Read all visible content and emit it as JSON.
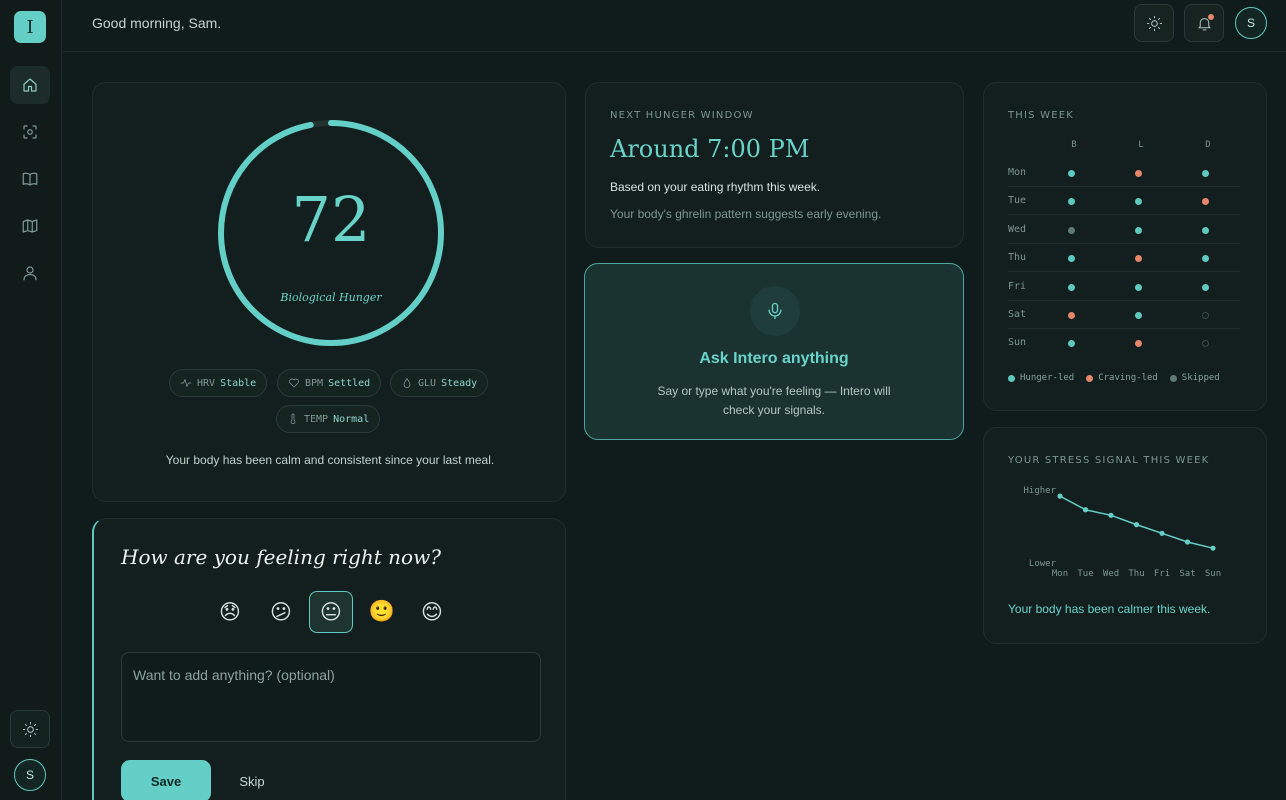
{
  "app": {
    "logo_letter": "I"
  },
  "header": {
    "greeting": "Good morning, Sam.",
    "avatar_initial": "S"
  },
  "sidebar": {
    "items": [
      {
        "name": "home",
        "active": true
      },
      {
        "name": "scan",
        "active": false
      },
      {
        "name": "journal",
        "active": false
      },
      {
        "name": "map",
        "active": false
      },
      {
        "name": "profile",
        "active": false
      }
    ],
    "avatar_initial": "S"
  },
  "hunger": {
    "value": "72",
    "value_fraction": 0.97,
    "label": "Biological Hunger",
    "chips": [
      {
        "key": "HRV",
        "value": "Stable",
        "icon": "pulse-icon"
      },
      {
        "key": "BPM",
        "value": "Settled",
        "icon": "heart-icon"
      },
      {
        "key": "GLU",
        "value": "Steady",
        "icon": "drop-icon"
      },
      {
        "key": "TEMP",
        "value": "Normal",
        "icon": "thermometer-icon"
      }
    ],
    "note": "Your body has been calm and consistent since your last meal."
  },
  "feeling": {
    "title": "How are you feeling right now?",
    "emojis": [
      "😞",
      "😕",
      "😐",
      "🙂",
      "😊"
    ],
    "selected_index": 2,
    "placeholder": "Want to add anything? (optional)",
    "save_label": "Save",
    "skip_label": "Skip"
  },
  "next_window": {
    "eyebrow": "NEXT HUNGER WINDOW",
    "time": "Around 7:00 PM",
    "line1": "Based on your eating rhythm this week.",
    "line2": "Your body's ghrelin pattern suggests early evening."
  },
  "ask": {
    "title": "Ask Intero anything",
    "subtitle": "Say or type what you're feeling — Intero will check your signals."
  },
  "week": {
    "eyebrow": "THIS WEEK",
    "columns": [
      "B",
      "L",
      "D"
    ],
    "rows": [
      {
        "day": "Mon",
        "meals": [
          "hunger",
          "craving",
          "hunger"
        ]
      },
      {
        "day": "Tue",
        "meals": [
          "hunger",
          "hunger",
          "craving"
        ]
      },
      {
        "day": "Wed",
        "meals": [
          "skipped",
          "hunger",
          "hunger"
        ]
      },
      {
        "day": "Thu",
        "meals": [
          "hunger",
          "craving",
          "hunger"
        ]
      },
      {
        "day": "Fri",
        "meals": [
          "hunger",
          "hunger",
          "hunger"
        ]
      },
      {
        "day": "Sat",
        "meals": [
          "craving",
          "hunger",
          "none"
        ]
      },
      {
        "day": "Sun",
        "meals": [
          "hunger",
          "craving",
          "none"
        ]
      }
    ],
    "legend": [
      {
        "key": "hunger",
        "label": "Hunger-led"
      },
      {
        "key": "craving",
        "label": "Craving-led"
      },
      {
        "key": "skipped",
        "label": "Skipped"
      }
    ],
    "colors": {
      "hunger": "#5fc9bf",
      "craving": "#e6876b",
      "skipped": "#5f7a76",
      "none": "#3a4b49"
    }
  },
  "stress": {
    "eyebrow": "YOUR STRESS SIGNAL THIS WEEK",
    "note": "Your body has been calmer this week.",
    "chart_data": {
      "type": "line",
      "categories": [
        "Mon",
        "Tue",
        "Wed",
        "Thu",
        "Fri",
        "Sat",
        "Sun"
      ],
      "values": [
        0.95,
        0.73,
        0.64,
        0.49,
        0.35,
        0.21,
        0.11
      ],
      "ylabel_top": "Higher",
      "ylabel_bottom": "Lower",
      "ylim": [
        0,
        1
      ],
      "grid": false
    }
  }
}
